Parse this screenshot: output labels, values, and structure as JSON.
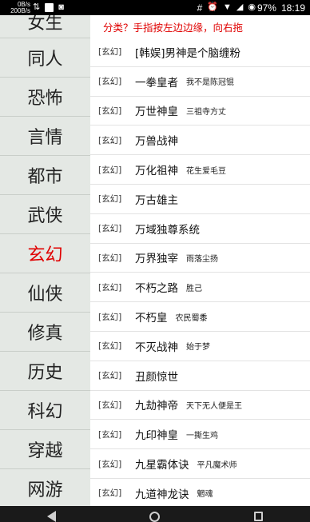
{
  "status_bar": {
    "net_down": "0B/s",
    "net_up": "200B/s",
    "time": "18:19",
    "battery": "97%"
  },
  "sidebar": {
    "items": [
      {
        "label": "女生"
      },
      {
        "label": "同人"
      },
      {
        "label": "恐怖"
      },
      {
        "label": "言情"
      },
      {
        "label": "都市"
      },
      {
        "label": "武侠"
      },
      {
        "label": "玄幻"
      },
      {
        "label": "仙侠"
      },
      {
        "label": "修真"
      },
      {
        "label": "历史"
      },
      {
        "label": "科幻"
      },
      {
        "label": "穿越"
      },
      {
        "label": "网游"
      }
    ],
    "active": "玄幻",
    "active_color": "#e00000"
  },
  "hint": "分类？手指按左边边缘，向右拖",
  "books": [
    {
      "tag": "[玄幻]",
      "title": "[韩娱]男神是个脑缠粉",
      "author": ""
    },
    {
      "tag": "[玄幻]",
      "title": "一拳皇者",
      "author": "我不是陈冠锟"
    },
    {
      "tag": "[玄幻]",
      "title": "万世神皇",
      "author": "三祖寺方丈"
    },
    {
      "tag": "[玄幻]",
      "title": "万兽战神",
      "author": ""
    },
    {
      "tag": "[玄幻]",
      "title": "万化祖神",
      "author": "花生爱毛豆"
    },
    {
      "tag": "[玄幻]",
      "title": "万古雄主",
      "author": ""
    },
    {
      "tag": "[玄幻]",
      "title": "万域独尊系统",
      "author": ""
    },
    {
      "tag": "[玄幻]",
      "title": "万界独宰",
      "author": "雨落尘扬"
    },
    {
      "tag": "[玄幻]",
      "title": "不朽之路",
      "author": "胜己"
    },
    {
      "tag": "[玄幻]",
      "title": "不朽皇",
      "author": "农民蜀黍"
    },
    {
      "tag": "[玄幻]",
      "title": "不灭战神",
      "author": "始于梦"
    },
    {
      "tag": "[玄幻]",
      "title": "丑颜惊世",
      "author": ""
    },
    {
      "tag": "[玄幻]",
      "title": "九劫神帝",
      "author": "天下无人便是王"
    },
    {
      "tag": "[玄幻]",
      "title": "九印神皇",
      "author": "一撕生鸡"
    },
    {
      "tag": "[玄幻]",
      "title": "九星霸体诀",
      "author": "平凡魔术师"
    },
    {
      "tag": "[玄幻]",
      "title": "九道神龙诀",
      "author": "魍魂"
    }
  ],
  "icons": {
    "status_left": [
      "image-icon",
      "cat-icon"
    ],
    "status_right": [
      "hash-icon",
      "alarm-icon",
      "wifi-icon",
      "signal-icon",
      "battery-icon"
    ],
    "nav": [
      "back-icon",
      "home-icon",
      "recent-apps-icon"
    ]
  }
}
